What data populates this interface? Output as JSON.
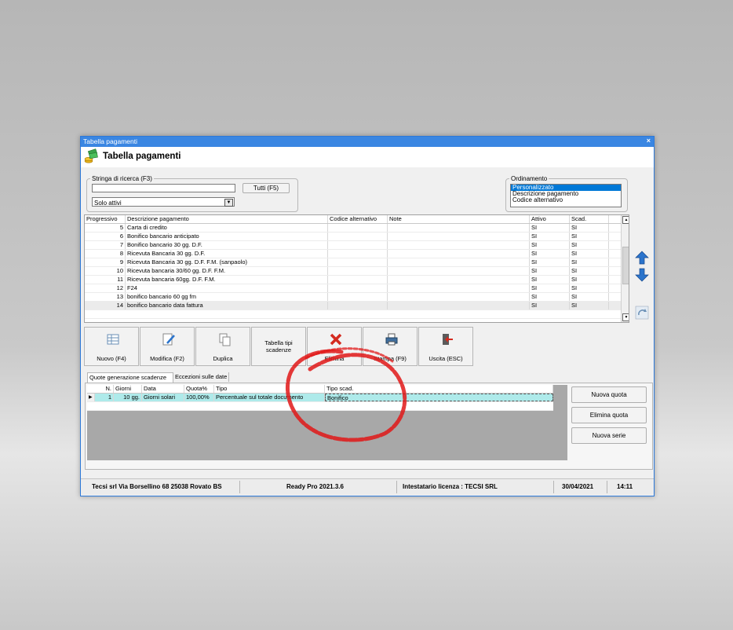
{
  "window": {
    "title": "Tabella pagamenti",
    "close": "×",
    "header_title": "Tabella pagamenti"
  },
  "search": {
    "legend": "Stringa di ricerca (F3)",
    "value": "",
    "all_button": "Tutti (F5)",
    "filter_selected": "Solo attivi"
  },
  "ordering": {
    "legend": "Ordinamento",
    "options": [
      "Personalizzato",
      "Descrizione pagamento",
      "Codice alternativo"
    ],
    "selected_index": 0
  },
  "table": {
    "columns": [
      "Progressivo",
      "Descrizione pagamento",
      "Codice alternativo",
      "Note",
      "Attivo",
      "Scad."
    ],
    "rows": [
      {
        "prog": "5",
        "desc": "Carta di credito",
        "alt": "",
        "note": "",
        "active": "SI",
        "scad": "SI"
      },
      {
        "prog": "6",
        "desc": "Bonifico bancario anticipato",
        "alt": "",
        "note": "",
        "active": "SI",
        "scad": "SI"
      },
      {
        "prog": "7",
        "desc": "Bonifico bancario 30 gg. D.F.",
        "alt": "",
        "note": "",
        "active": "SI",
        "scad": "SI"
      },
      {
        "prog": "8",
        "desc": "Ricevuta Bancaria 30 gg. D.F.",
        "alt": "",
        "note": "",
        "active": "SI",
        "scad": "SI"
      },
      {
        "prog": "9",
        "desc": "Ricevuta Bancaria 30 gg. D.F. F.M. (sanpaolo)",
        "alt": "",
        "note": "",
        "active": "SI",
        "scad": "SI"
      },
      {
        "prog": "10",
        "desc": "Ricevuta bancaria 30/60 gg. D.F. F.M.",
        "alt": "",
        "note": "",
        "active": "SI",
        "scad": "SI"
      },
      {
        "prog": "11",
        "desc": "Ricevuta bancaria 60gg. D.F. F.M.",
        "alt": "",
        "note": "",
        "active": "SI",
        "scad": "SI"
      },
      {
        "prog": "12",
        "desc": "F24",
        "alt": "",
        "note": "",
        "active": "SI",
        "scad": "SI"
      },
      {
        "prog": "13",
        "desc": "bonifico bancario 60 gg fm",
        "alt": "",
        "note": "",
        "active": "SI",
        "scad": "SI"
      },
      {
        "prog": "14",
        "desc": "bonifico bancario data fattura",
        "alt": "",
        "note": "",
        "active": "SI",
        "scad": "SI"
      }
    ]
  },
  "toolbar": {
    "nuovo": "Nuovo (F4)",
    "modifica": "Modifica (F2)",
    "duplica": "Duplica",
    "tabella_line1": "Tabella tipi",
    "tabella_line2": "scadenze",
    "elimina": "Elimina",
    "stampa": "Stampa (F9)",
    "uscita": "Uscita (ESC)"
  },
  "tabs": [
    "Quote generazione scadenze",
    "Eccezioni sulle date"
  ],
  "quote": {
    "columns": [
      "N.",
      "Giorni",
      "Data",
      "Quota%",
      "Tipo",
      "Tipo scad."
    ],
    "rows": [
      {
        "marker": "▶",
        "n": "1",
        "giorni": "10 gg.",
        "data": "Giorni solari",
        "quota": "100,00%",
        "tipo": "Percentuale sul totale documento",
        "tipo_scad": "Bonifico"
      }
    ],
    "buttons": {
      "nuova_quota": "Nuova quota",
      "elimina_quota": "Elimina quota",
      "nuova_serie": "Nuova serie"
    }
  },
  "status": {
    "company": "Tecsi srl Via Borsellino 68  25038 Rovato BS",
    "version": "Ready Pro 2021.3.6",
    "license": "Intestatario licenza : TECSI SRL",
    "date": "30/04/2021",
    "time": "14:11"
  },
  "colors": {
    "titlebar": "#3a86e2",
    "selection": "#0078d7",
    "quote_row": "#aeeaea",
    "annotation": "#e01818"
  }
}
